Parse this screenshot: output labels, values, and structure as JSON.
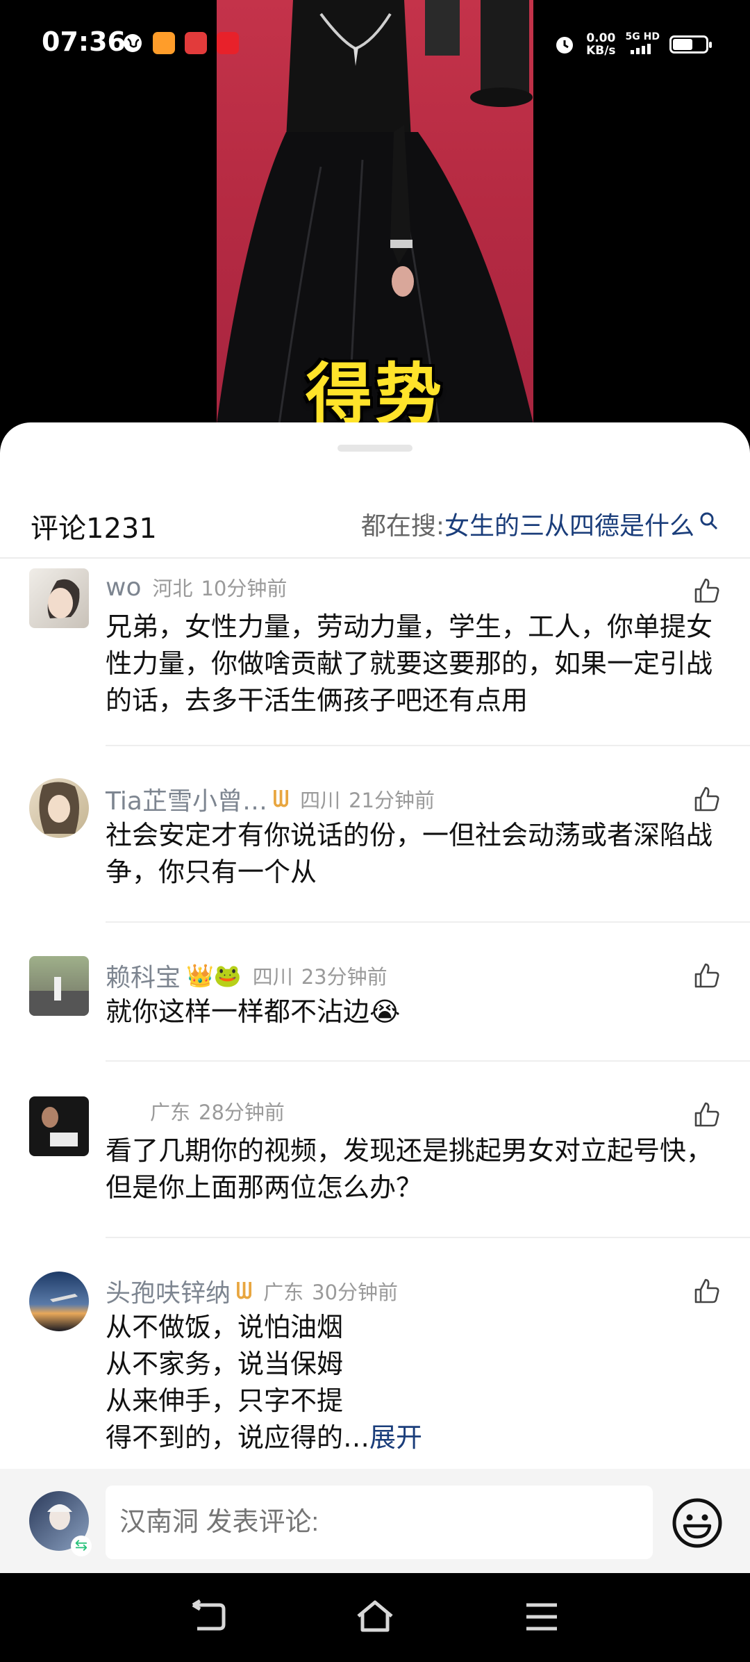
{
  "status_bar": {
    "time": "07:36",
    "net_speed_value": "0.00",
    "net_speed_unit": "KB/s",
    "network": "5G HD",
    "battery_level": 0.6
  },
  "video": {
    "caption": "得势"
  },
  "comments_panel": {
    "title": "评论1231",
    "hot_search_prefix": "都在搜: ",
    "hot_search_query": "女生的三从四德是什么",
    "comments": [
      {
        "nickname": "wo",
        "badge": "",
        "region": "河北",
        "time": "10分钟前",
        "text": "兄弟，女性力量，劳动力量，学生，工人，你单提女性力量，你做啥贡献了就要这要那的，如果一定引战的话，去多干活生俩孩子吧还有点用"
      },
      {
        "nickname": "Tia芷雪小曾…",
        "badge": "ᗯ",
        "region": "四川",
        "time": "21分钟前",
        "text": "社会安定才有你说话的份，一但社会动荡或者深陷战争，你只有一个从"
      },
      {
        "nickname": "赖科宝",
        "badge": "👑🐸",
        "region": "四川",
        "time": "23分钟前",
        "text": "就你这样一样都不沾边😭"
      },
      {
        "nickname": "",
        "badge": "",
        "region": "广东",
        "time": "28分钟前",
        "text": "看了几期你的视频，发现还是挑起男女对立起号快，但是你上面那两位怎么办？"
      },
      {
        "nickname": "头孢呋锌纳",
        "badge": "ᗯ",
        "region": "广东",
        "time": "30分钟前",
        "lines": [
          "从不做饭，说怕油烟",
          "从不家务，说当保姆",
          "从来伸手，只字不提",
          "得不到的，说应得的…"
        ],
        "expand": "展开"
      }
    ]
  },
  "input_bar": {
    "placeholder": "汉南洞 发表评论:"
  },
  "colors": {
    "accent_link": "#1a3d7a",
    "caption_yellow": "#ffe32a",
    "carpet_red": "#c4334a"
  }
}
